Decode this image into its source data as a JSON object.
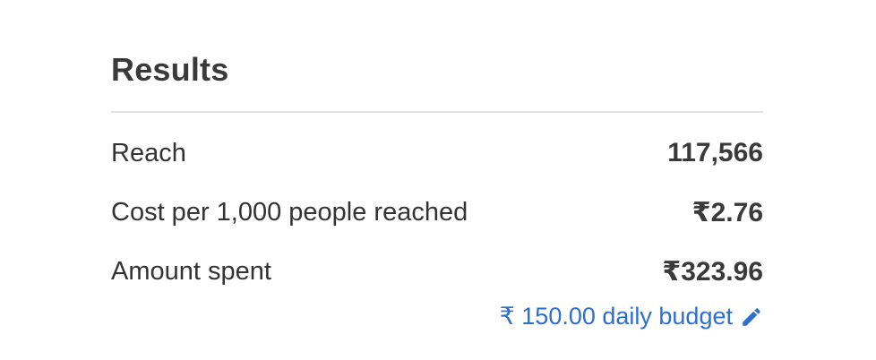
{
  "results": {
    "title": "Results",
    "rows": [
      {
        "label": "Reach",
        "value": "117,566"
      },
      {
        "label": "Cost per 1,000 people reached",
        "value": "₹2.76"
      },
      {
        "label": "Amount spent",
        "value": "₹323.96"
      }
    ],
    "budget_link": "₹ 150.00 daily budget",
    "budget_icon": "pencil-icon",
    "colors": {
      "link": "#2d6fce",
      "text": "#333333",
      "divider": "#e3e3e3"
    }
  }
}
